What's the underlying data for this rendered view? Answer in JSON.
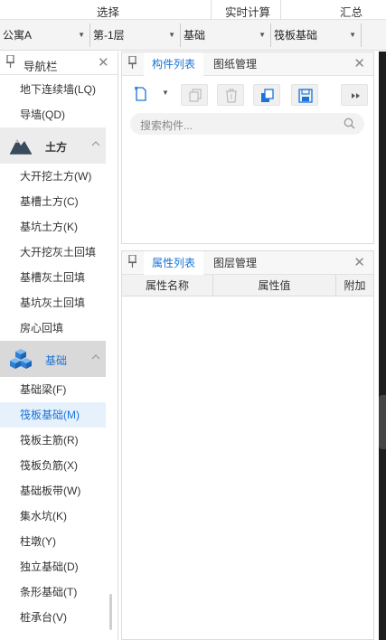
{
  "ribbon": {
    "select": "选择",
    "realtime_calc": "实时计算",
    "summary": "汇总"
  },
  "selectors": [
    {
      "value": "公寓A"
    },
    {
      "value": "第-1层"
    },
    {
      "value": "基础"
    },
    {
      "value": "筏板基础"
    }
  ],
  "nav": {
    "title": "导航栏",
    "items_top": [
      "地下连续墙(LQ)",
      "导墙(QD)"
    ],
    "cat_earth": "土方",
    "items_earth": [
      "大开挖土方(W)",
      "基槽土方(C)",
      "基坑土方(K)",
      "大开挖灰土回填",
      "基槽灰土回填",
      "基坑灰土回填",
      "房心回填"
    ],
    "cat_foundation": "基础",
    "items_foundation": [
      "基础梁(F)",
      "筏板基础(M)",
      "筏板主筋(R)",
      "筏板负筋(X)",
      "基础板带(W)",
      "集水坑(K)",
      "柱墩(Y)",
      "独立基础(D)",
      "条形基础(T)",
      "桩承台(V)"
    ],
    "active_item": "筏板基础(M)"
  },
  "component_panel": {
    "tabs": [
      "构件列表",
      "图纸管理"
    ],
    "search_placeholder": "搜索构件..."
  },
  "property_panel": {
    "tabs": [
      "属性列表",
      "图层管理"
    ],
    "columns": [
      "属性名称",
      "属性值",
      "附加"
    ]
  },
  "icons": {
    "close": "close-icon",
    "pin": "pin-icon",
    "search": "search-icon"
  },
  "colors": {
    "accent": "#1a73d9",
    "active_bg": "#e6f1fc"
  }
}
